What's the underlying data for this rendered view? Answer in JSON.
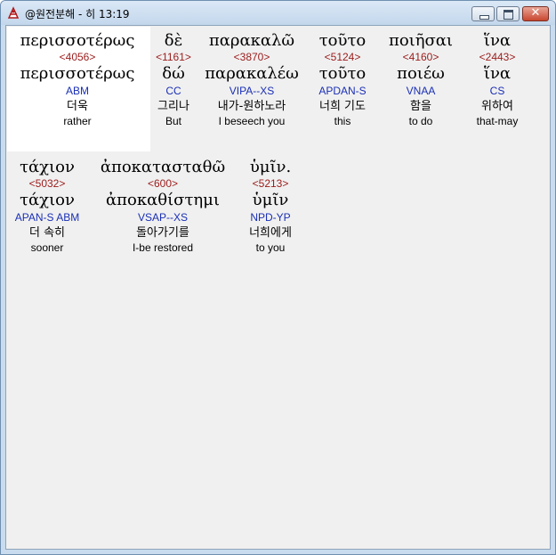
{
  "window": {
    "title": "@원전분해 - 히 13:19",
    "close_glyph": "✕"
  },
  "words": [
    {
      "greek": "περισσοτέρως",
      "strong": "<4056>",
      "lemma": "περισσοτέρως",
      "morph": "ABM",
      "korean": "더욱",
      "english": "rather"
    },
    {
      "greek": "δὲ",
      "strong": "<1161>",
      "lemma": "δώ",
      "morph": "CC",
      "korean": "그리나",
      "english": "But"
    },
    {
      "greek": "παρακαλῶ",
      "strong": "<3870>",
      "lemma": "παρακαλέω",
      "morph": "VIPA--XS",
      "korean": "내가-원하노라",
      "english": "I beseech you"
    },
    {
      "greek": "τοῦτο",
      "strong": "<5124>",
      "lemma": "τοῦτο",
      "morph": "APDAN-S",
      "korean": "너희 기도",
      "english": "this"
    },
    {
      "greek": "ποιῆσαι",
      "strong": "<4160>",
      "lemma": "ποιέω",
      "morph": "VNAA",
      "korean": "함을",
      "english": "to do"
    },
    {
      "greek": "ἵνα",
      "strong": "<2443>",
      "lemma": "ἵνα",
      "morph": "CS",
      "korean": "위하여",
      "english": "that-may"
    },
    {
      "greek": "τάχιον",
      "strong": "<5032>",
      "lemma": "τάχιον",
      "morph": "APAN-S ABM",
      "korean": "더 속히",
      "english": "sooner"
    },
    {
      "greek": "ἀποκατασταθῶ",
      "strong": "<600>",
      "lemma": "ἀποκαθίστημι",
      "morph": "VSAP--XS",
      "korean": "돌아가기를",
      "english": "I-be restored"
    },
    {
      "greek": "ὑμῖν.",
      "strong": "<5213>",
      "lemma": "ὑμῖν",
      "morph": "NPD-YP",
      "korean": "너희에게",
      "english": "to you"
    }
  ]
}
